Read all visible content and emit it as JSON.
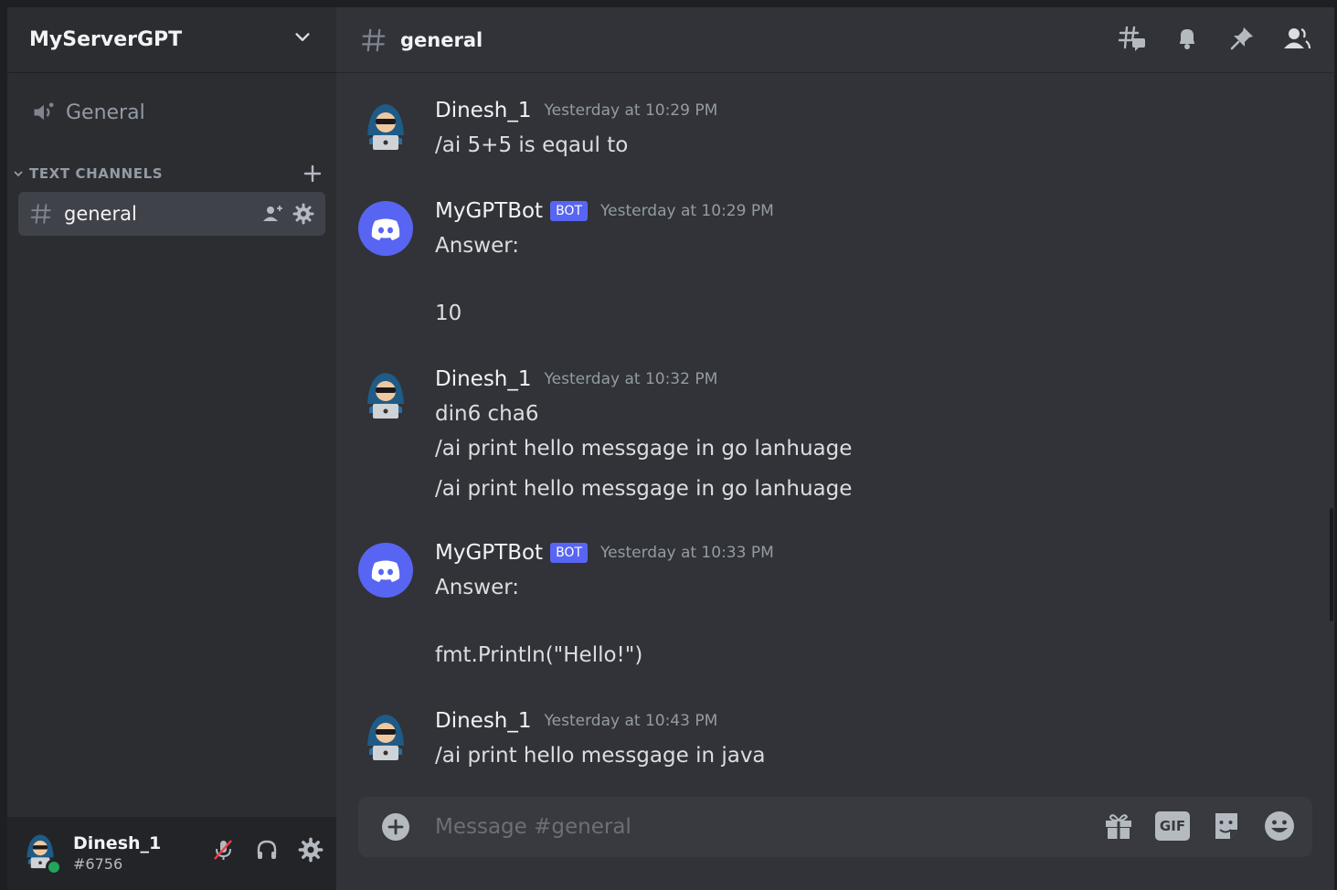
{
  "server": {
    "name": "MyServerGPT"
  },
  "sidebar": {
    "voice_channel": "General",
    "category": "TEXT CHANNELS",
    "active_channel": "general"
  },
  "user_panel": {
    "name": "Dinesh_1",
    "tag": "#6756",
    "status_color": "#23a55a"
  },
  "header": {
    "channel": "general"
  },
  "messages": [
    {
      "author": "Dinesh_1",
      "bot": false,
      "time": "Yesterday at 10:29 PM",
      "lines": [
        "/ai 5+5 is eqaul to"
      ]
    },
    {
      "author": "MyGPTBot",
      "bot": true,
      "badge": "BOT",
      "time": "Yesterday at 10:29 PM",
      "lines": [
        "Answer:",
        "10"
      ]
    },
    {
      "author": "Dinesh_1",
      "bot": false,
      "time": "Yesterday at 10:32 PM",
      "lines": [
        "din6 cha6",
        "/ai print hello messgage in go lanhuage",
        "/ai print hello messgage in go lanhuage"
      ]
    },
    {
      "author": "MyGPTBot",
      "bot": true,
      "badge": "BOT",
      "time": "Yesterday at 10:33 PM",
      "lines": [
        "Answer:",
        "fmt.Println(\"Hello!\")"
      ]
    },
    {
      "author": "Dinesh_1",
      "bot": false,
      "time": "Yesterday at 10:43 PM",
      "lines": [
        "/ai print hello messgage in java"
      ]
    }
  ],
  "composer": {
    "placeholder": "Message #general",
    "gif_label": "GIF"
  },
  "colors": {
    "accent": "#5865f2",
    "background": "#313338",
    "sidebar": "#2b2d31"
  }
}
